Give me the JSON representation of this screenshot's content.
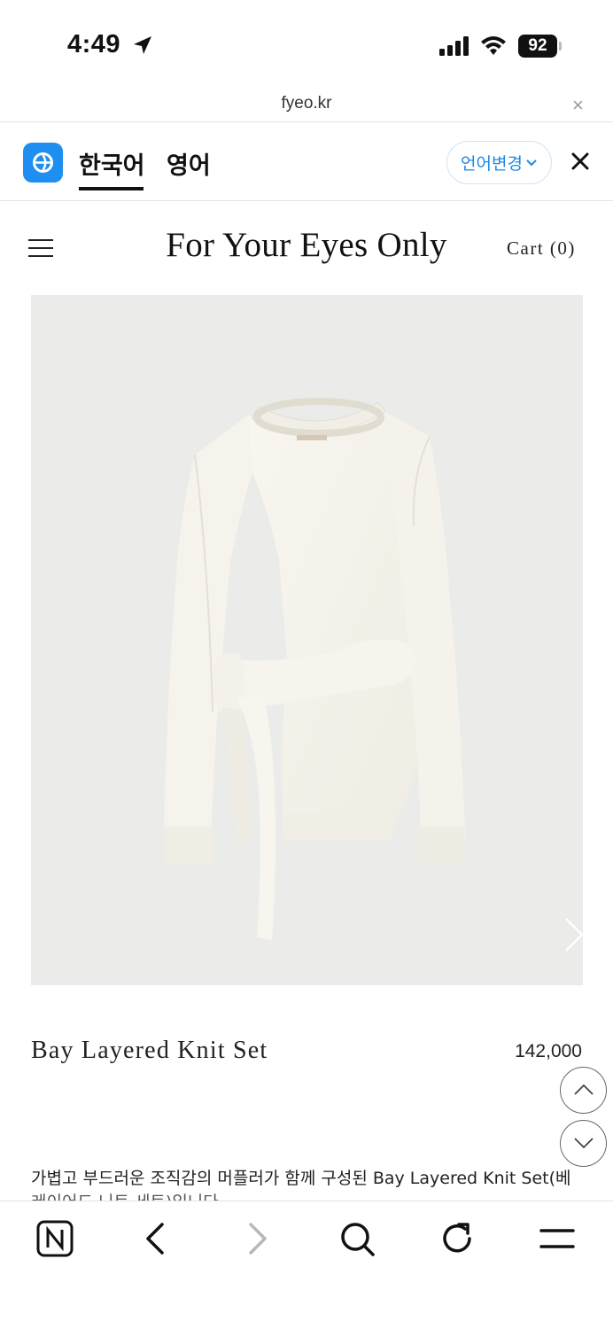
{
  "status_bar": {
    "time": "4:49",
    "battery": "92"
  },
  "browser": {
    "url": "fyeo.kr",
    "close_glyph": "×"
  },
  "translate_bar": {
    "tabs": [
      "한국어",
      "영어"
    ],
    "active_tab": "한국어",
    "change_language_label": "언어변경"
  },
  "site": {
    "title": "For Your Eyes Only",
    "cart_label": "Cart (0)"
  },
  "product": {
    "name": "Bay Layered Knit Set",
    "price": "142,000",
    "description": "가볍고 부드러운 조직감의 머플러가 함께 구성된 Bay Layered Knit Set(베이",
    "description_cut": "레이어드 니트 세트)입니다."
  },
  "icons": {
    "location": "location-arrow-icon",
    "signal": "cellular-signal-icon",
    "wifi": "wifi-icon",
    "battery": "battery-icon",
    "translate_logo": "translate-logo-icon",
    "menu": "hamburger-menu-icon",
    "next": "chevron-right-icon",
    "scroll_up": "chevron-up-icon",
    "scroll_down": "chevron-down-icon",
    "toolbar": [
      "naver-home-icon",
      "back-icon",
      "forward-icon",
      "search-icon",
      "reload-icon",
      "menu-icon"
    ]
  },
  "colors": {
    "accent": "#1e88e5",
    "image_bg": "#ebebea",
    "text": "#222222"
  }
}
